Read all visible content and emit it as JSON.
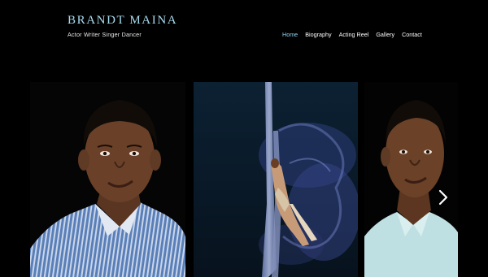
{
  "site": {
    "title": "BRANDT MAINA",
    "tagline": "Actor  Writer  Singer  Dancer"
  },
  "nav": {
    "items": [
      {
        "label": "Home",
        "active": true
      },
      {
        "label": "Biography",
        "active": false
      },
      {
        "label": "Acting Reel",
        "active": false
      },
      {
        "label": "Gallery",
        "active": false
      },
      {
        "label": "Contact",
        "active": false
      }
    ]
  },
  "gallery": {
    "photos": [
      {
        "subject": "portrait-striped-shirt"
      },
      {
        "subject": "aerial-silk-performance"
      },
      {
        "subject": "portrait-light-shirt"
      }
    ],
    "next_icon": "chevron-right-icon"
  },
  "colors": {
    "background": "#000000",
    "title": "#a8dcef",
    "nav_active": "#8fd3f0",
    "nav_text": "#ffffff"
  }
}
